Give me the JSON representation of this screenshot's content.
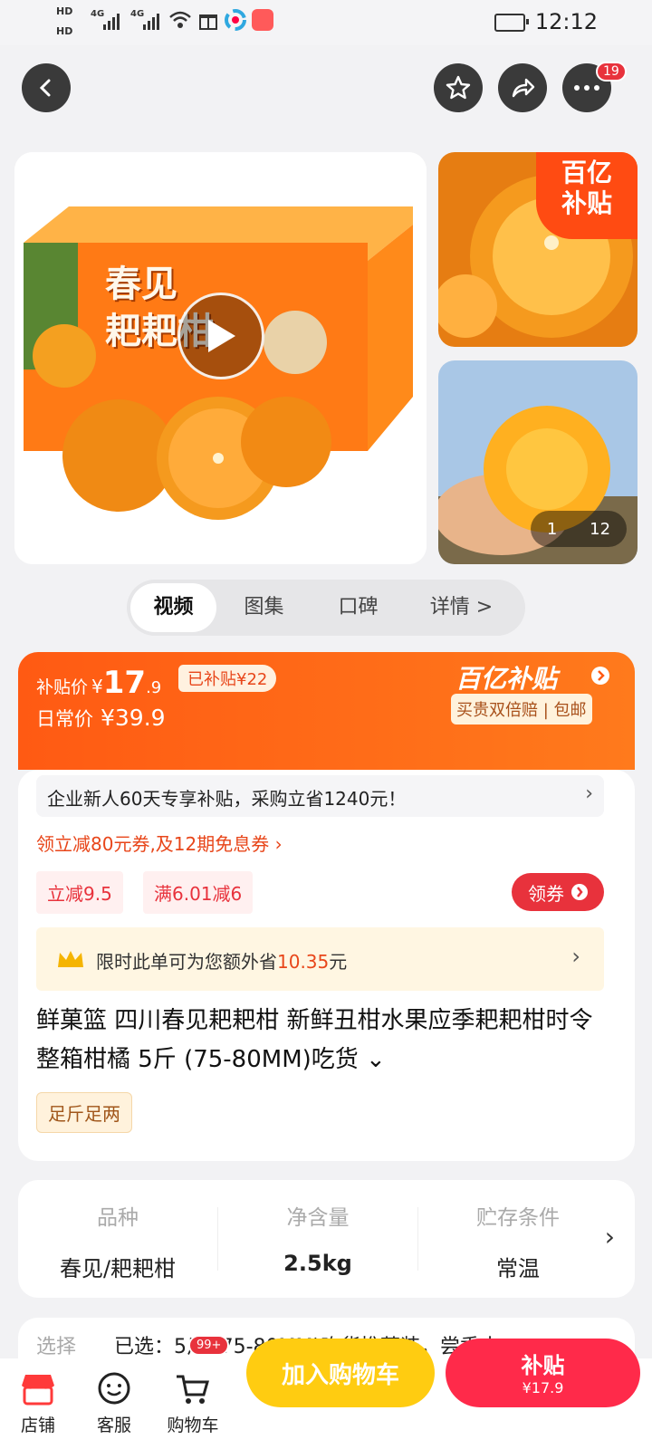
{
  "status_bar": {
    "hd1": "HD",
    "hd2": "HD",
    "net1": "4G",
    "net2": "4G",
    "time": "12:12"
  },
  "nav": {
    "badge": "19"
  },
  "gallery": {
    "box_title_line1": "春见",
    "box_title_line2": "耙耙柑",
    "box_top_text": "春见 耙耙柑",
    "subsidy_badge_top": "百亿",
    "subsidy_badge_bottom": "补贴",
    "counter_current": "1",
    "counter_total": "12"
  },
  "tabs": [
    "视频",
    "图集",
    "口碑",
    "详情 >"
  ],
  "price": {
    "label": "补贴价",
    "symbol": "¥",
    "integer": "17",
    "decimal": ".9",
    "subsidized": "已补贴¥22",
    "daily_label": "日常价",
    "daily_value": "¥39.9",
    "brand_text": "百亿补贴",
    "guarantee": "买贵双倍赔 | 包邮"
  },
  "info": {
    "enterprise_banner": "企业新人60天专享补贴，采购立省1240元！",
    "enterprise_arrow": "›",
    "coupon_line": "领立减80元券,及12期免息券 ›",
    "tag1": "立减9.5",
    "tag2": "满6.01减6",
    "get_coupon": "领券",
    "save_prefix": "限时此单可为您额外省",
    "save_amount": "10.35",
    "save_suffix": "元",
    "title": "鲜菓篮 四川春见耙耙柑 新鲜丑柑水果应季耙耙柑时令整箱柑橘 5斤 (75-80MM)吃货 ⌄",
    "tag_weight": "足斤足两"
  },
  "attributes": [
    {
      "label": "品种",
      "value": "春见/耙耙柑"
    },
    {
      "label": "净含量",
      "value": "2.5kg"
    },
    {
      "label": "贮存条件",
      "value": "常温"
    }
  ],
  "select_row": {
    "label": "选择",
    "value": "已选：5斤 (75-80MM)吃货推荐装，尝香水 ›"
  },
  "bottom_bar": {
    "shop": "店铺",
    "service": "客服",
    "cart": "购物车",
    "cart_badge": "99+",
    "add_cart": "加入购物车",
    "buy": "补贴",
    "buy_price": "¥17.9"
  },
  "colors": {
    "accent": "#ff5a13",
    "cart_button": "#ffcc11",
    "buy_button": "#ff2a4a",
    "coupon_red": "#e8323c"
  }
}
